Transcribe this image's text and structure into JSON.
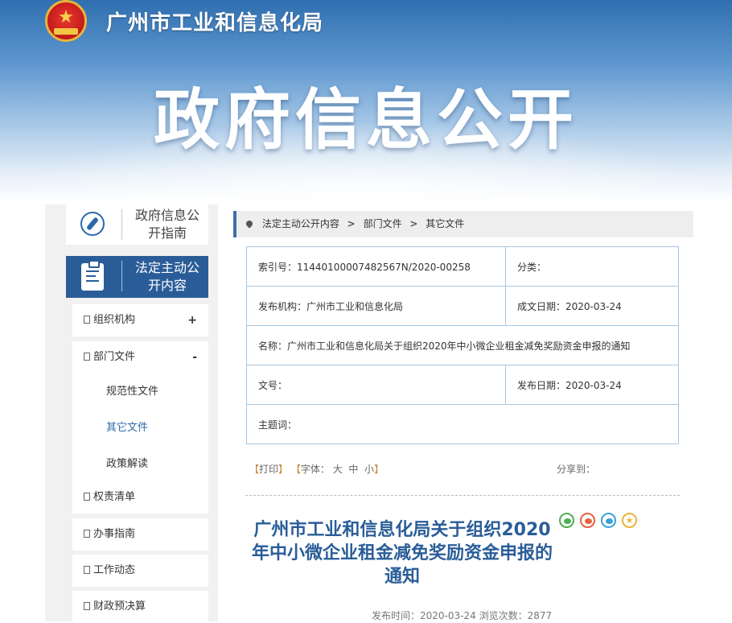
{
  "header": {
    "site_title": "广州市工业和信息化局",
    "banner_title": "政府信息公开"
  },
  "sidebar": {
    "guide_label": "政府信息公开指南",
    "legal_label": "法定主动公开内容",
    "menu": [
      {
        "label": "组织机构",
        "toggle": "+"
      },
      {
        "label": "部门文件",
        "toggle": "-"
      }
    ],
    "submenu": [
      "规范性文件",
      "其它文件",
      "政策解读"
    ],
    "menu_rest": [
      "权责清单",
      "办事指南",
      "工作动态",
      "财政预决算"
    ]
  },
  "breadcrumb": [
    "法定主动公开内容",
    "部门文件",
    "其它文件"
  ],
  "info": {
    "index_no": "索引号：11440100007482567N/2020-00258",
    "category": "分类：",
    "publisher": "发布机构：广州市工业和信息化局",
    "created_date": "成文日期：2020-03-24",
    "name": "名称：广州市工业和信息化局关于组织2020年中小微企业租金减免奖励资金申报的通知",
    "doc_no": "文号：",
    "publish_date": "发布日期：2020-03-24",
    "subject": "主题词："
  },
  "tools": {
    "print": "打印",
    "font_label": "字体：",
    "font_large": "大",
    "font_medium": "中",
    "font_small": "小",
    "share_label": "分享到："
  },
  "article": {
    "title": "广州市工业和信息化局关于组织2020年中小微企业租金减免奖励资金申报的通知",
    "publish_time": "发布时间：2020-03-24",
    "views": "浏览次数：2877"
  }
}
